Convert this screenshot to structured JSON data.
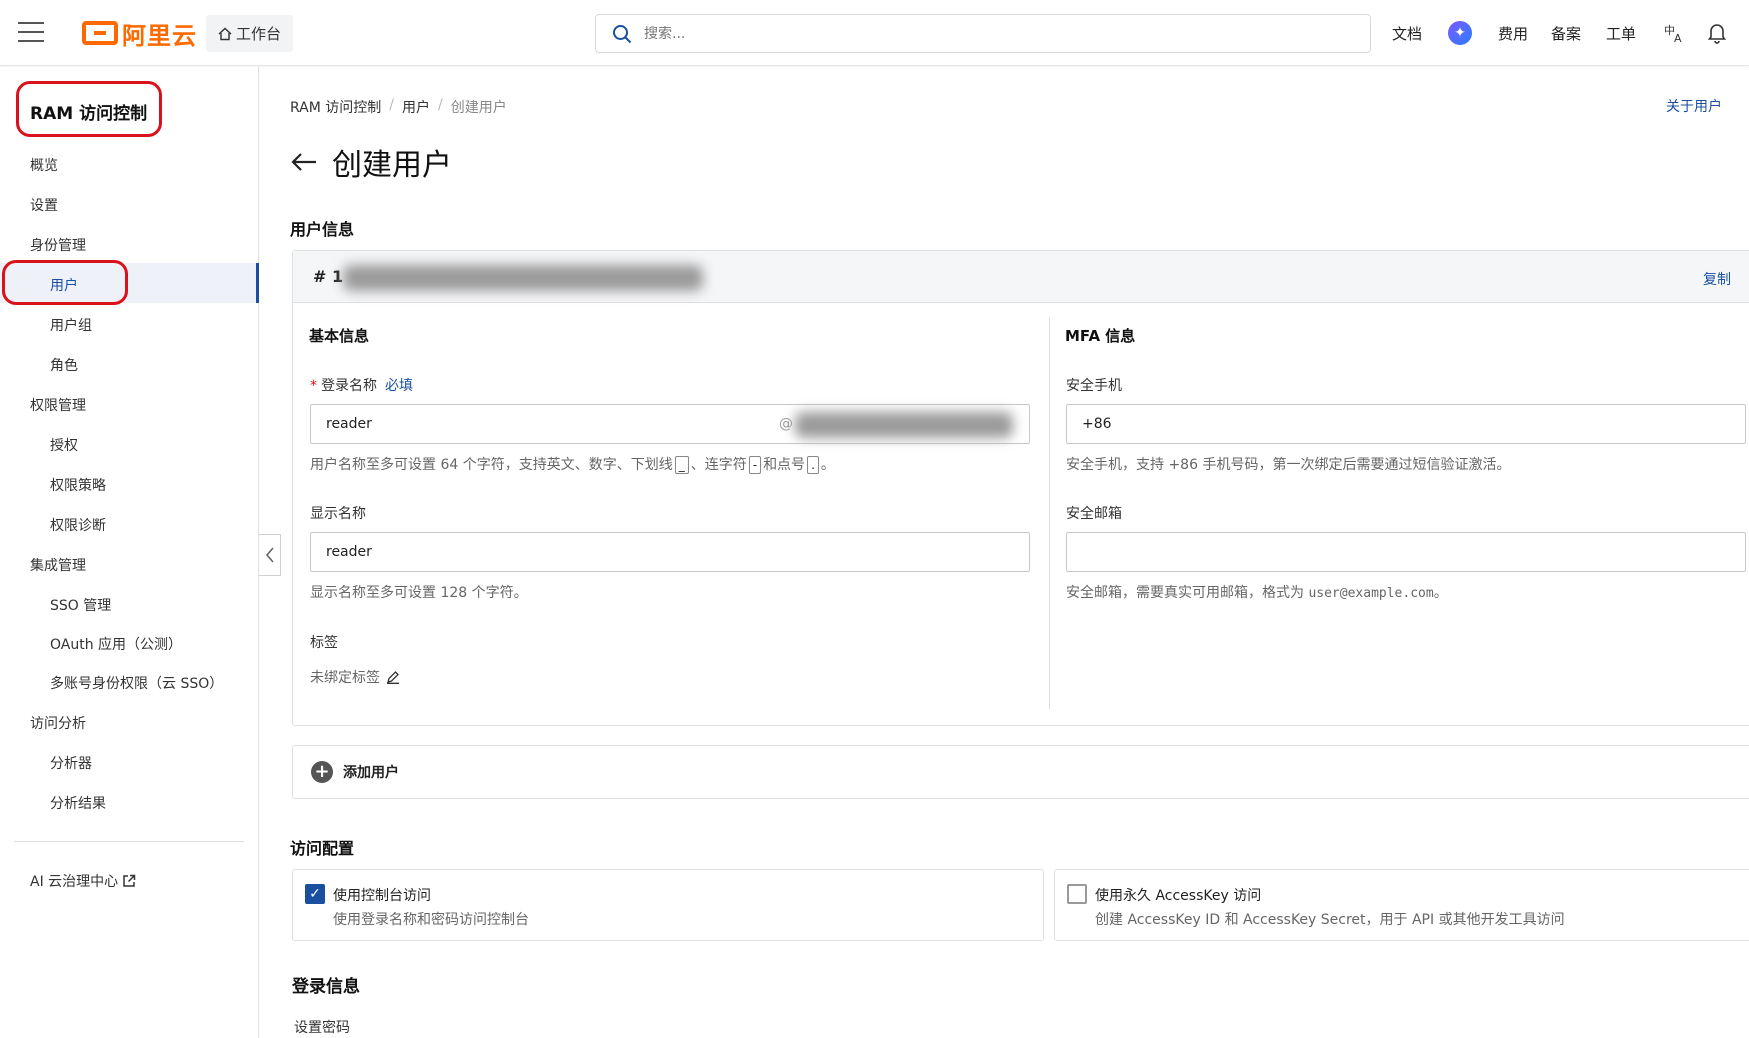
{
  "topbar": {
    "logo_text": "阿里云",
    "workbench_label": "工作台",
    "search_placeholder": "搜索...",
    "nav": {
      "docs": "文档",
      "fees": "费用",
      "filing": "备案",
      "tickets": "工单"
    }
  },
  "sidebar": {
    "title": "RAM 访问控制",
    "items": {
      "overview": "概览",
      "settings": "设置",
      "identity": "身份管理",
      "users": "用户",
      "user_groups": "用户组",
      "roles": "角色",
      "permissions": "权限管理",
      "grant": "授权",
      "policies": "权限策略",
      "diagnose": "权限诊断",
      "integration": "集成管理",
      "sso": "SSO 管理",
      "oauth": "OAuth 应用（公测）",
      "multi_account": "多账号身份权限（云 SSO）",
      "access_analysis": "访问分析",
      "analyzer": "分析器",
      "analysis_results": "分析结果",
      "ai_center": "AI 云治理中心"
    }
  },
  "breadcrumb": [
    "RAM 访问控制",
    "用户",
    "创建用户"
  ],
  "breadcrumb_sep": "/",
  "about_link": "关于用户",
  "page_title": "创建用户",
  "user_info": {
    "section_title": "用户信息",
    "card_number": "# 1",
    "copy_label": "复制",
    "basic_title": "基本信息",
    "mfa_title": "MFA 信息",
    "login_name_label": "登录名称",
    "login_name_required_mark": "*",
    "login_name_hint": "必填",
    "login_name_value": "reader",
    "login_name_at": "@",
    "login_name_help_1": "用户名称至多可设置 64 个字符，支持英文、数字、下划线",
    "login_name_help_2": "、连字符",
    "login_name_help_3": "和点号",
    "login_name_help_4": "。",
    "kbd_underscore": "_",
    "kbd_dash": "-",
    "kbd_dot": ".",
    "display_name_label": "显示名称",
    "display_name_value": "reader",
    "display_name_help": "显示名称至多可设置 128 个字符。",
    "tags_label": "标签",
    "tags_value": "未绑定标签",
    "phone_label": "安全手机",
    "phone_value": "+86",
    "phone_help": "安全手机，支持 +86 手机号码，第一次绑定后需要通过短信验证激活。",
    "email_label": "安全邮箱",
    "email_value": "",
    "email_help_prefix": "安全邮箱，需要真实可用邮箱，格式为",
    "email_help_example": "user@example.com",
    "email_help_suffix": "。"
  },
  "add_user_label": "添加用户",
  "access_config": {
    "section_title": "访问配置",
    "console": {
      "title": "使用控制台访问",
      "desc": "使用登录名称和密码访问控制台",
      "checked": true
    },
    "accesskey": {
      "title": "使用永久 AccessKey 访问",
      "desc": "创建 AccessKey ID 和 AccessKey Secret，用于 API 或其他开发工具访问",
      "checked": false
    }
  },
  "login_info": {
    "section_title": "登录信息",
    "password_label": "设置密码"
  },
  "colors": {
    "brand": "#ff6a00",
    "link": "#1a4fa0",
    "highlight": "#d9121c"
  }
}
